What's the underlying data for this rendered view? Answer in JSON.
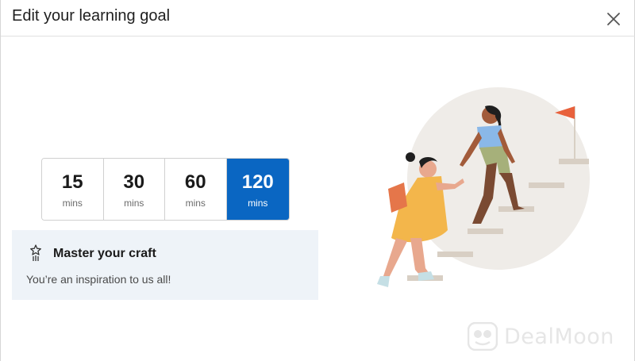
{
  "dialog": {
    "title": "Edit your learning goal",
    "close_icon": "close-icon"
  },
  "goal_options": [
    {
      "value": "15",
      "unit": "mins",
      "selected": false
    },
    {
      "value": "30",
      "unit": "mins",
      "selected": false
    },
    {
      "value": "60",
      "unit": "mins",
      "selected": false
    },
    {
      "value": "120",
      "unit": "mins",
      "selected": true
    }
  ],
  "goal_card": {
    "icon": "award-icon",
    "title": "Master your craft",
    "description": "You’re an inspiration to us all!"
  },
  "illustration": {
    "icon": "stairs-climbing-illustration"
  },
  "watermark": {
    "text": "DealMoon"
  },
  "colors": {
    "accent": "#0a66c2",
    "card_background": "#eef3f8",
    "flag": "#e8613c",
    "circle": "#efece8"
  }
}
